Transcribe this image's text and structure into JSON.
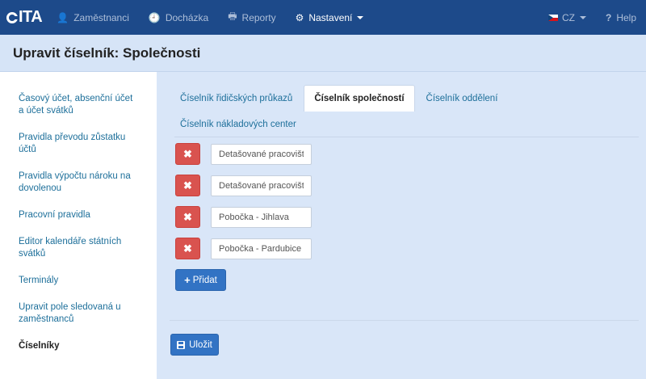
{
  "nav": {
    "logo": "ITA",
    "items": [
      {
        "label": "Zaměstnanci",
        "icon": "user-icon",
        "glyph": "👤"
      },
      {
        "label": "Docházka",
        "icon": "clock-icon",
        "glyph": "🕘"
      },
      {
        "label": "Reporty",
        "icon": "print-icon",
        "glyph": "🖶"
      },
      {
        "label": "Nastavení",
        "icon": "gear-icon",
        "glyph": "⚙"
      }
    ],
    "language": "CZ",
    "help": "Help",
    "help_glyph": "?"
  },
  "header": {
    "title": "Upravit číselník: Společnosti"
  },
  "sidebar": {
    "items": [
      {
        "label": "Časový účet, absenční účet a účet svátků"
      },
      {
        "label": "Pravidla převodu zůstatku účtů"
      },
      {
        "label": "Pravidla výpočtu nároku na dovolenou"
      },
      {
        "label": "Pracovní pravidla"
      },
      {
        "label": "Editor kalendáře státních svátků"
      },
      {
        "label": "Terminály"
      },
      {
        "label": "Upravit pole sledovaná u zaměstnanců"
      },
      {
        "label": "Číselníky"
      }
    ]
  },
  "tabs": [
    {
      "label": "Číselník řidičských průkazů"
    },
    {
      "label": "Číselník společností"
    },
    {
      "label": "Číselník oddělení"
    },
    {
      "label": "Číselník nákladových center"
    }
  ],
  "entries": [
    {
      "value": "Detašované pracoviště"
    },
    {
      "value": "Detašované pracoviště"
    },
    {
      "value": "Pobočka - Jihlava"
    },
    {
      "value": "Pobočka - Pardubice"
    }
  ],
  "delete_glyph": "✖",
  "buttons": {
    "add": "Přidat",
    "add_glyph": "+",
    "save": "Uložit"
  },
  "colors": {
    "navbar": "#1d4a8a",
    "header": "#d6e4f7",
    "main": "#d9e6f8",
    "danger": "#d9534f",
    "primary": "#3273c4",
    "link": "#1d6f9a"
  }
}
